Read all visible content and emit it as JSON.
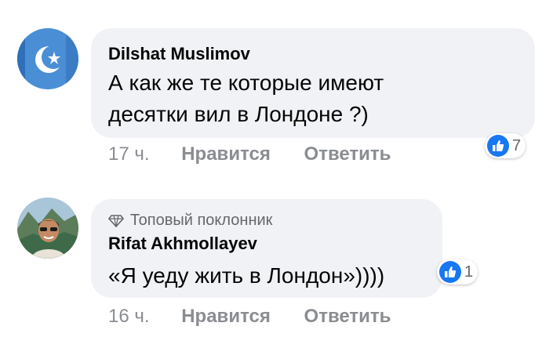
{
  "comments": [
    {
      "author": "Dilshat Muslimov",
      "text_line1": "А как же те  которые имеют",
      "text_line2": "десятки вил в Лондоне ?)",
      "time": "17 ч.",
      "like_label": "Нравится",
      "reply_label": "Ответить",
      "reaction_count": "7",
      "avatar_icon": "crescent-star-flag-icon"
    },
    {
      "badge": "Топовый поклонник",
      "badge_icon": "diamond-icon",
      "author": "Rifat Akhmollayev",
      "text_line1": "«Я уеду жить в Лондон»))))",
      "time": "16 ч.",
      "like_label": "Нравится",
      "reply_label": "Ответить",
      "reaction_count": "1",
      "avatar_icon": "person-photo-icon"
    }
  ],
  "colors": {
    "bubble": "#f0f2f5",
    "meta": "#8a8d91",
    "like_blue": "#1877f2",
    "flag_blue": "#4a8fd6"
  }
}
